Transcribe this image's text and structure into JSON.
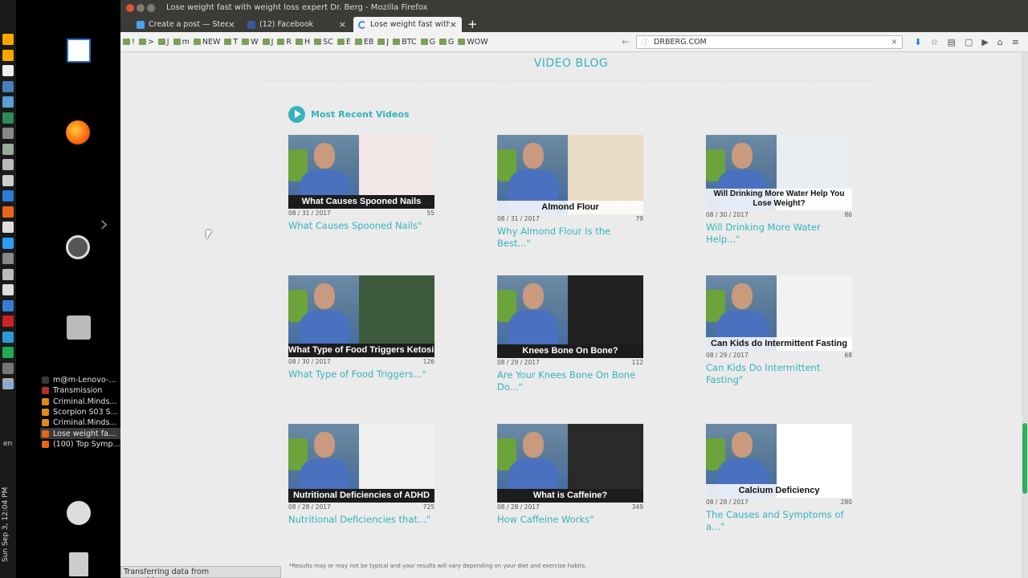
{
  "window": {
    "title": "Lose weight fast with weight loss expert Dr. Berg - Mozilla Firefox"
  },
  "tabs": [
    {
      "label": "Create a post — Steem",
      "favicon_color": "#4ba2f2"
    },
    {
      "label": "(12) Facebook",
      "favicon_color": "#3b5998"
    },
    {
      "label": "Lose weight fast with",
      "favicon_color": "#4a90d9"
    }
  ],
  "bookmarks": [
    "!",
    ">",
    "J",
    "m",
    "NEW",
    "T",
    "W",
    "J",
    "R",
    "H",
    "SC",
    "E",
    "EB",
    "J",
    "BTC",
    "G",
    "G",
    "WOW"
  ],
  "url": {
    "value": "DRBERG.COM",
    "info_icon": "info-icon"
  },
  "taskbar": {
    "items": [
      {
        "label": "m@m-Lenovo-...",
        "icon_color": "#3a3a3a",
        "active": false
      },
      {
        "label": "Transmission",
        "icon_color": "#b03030",
        "active": false
      },
      {
        "label": "Criminal.Minds...",
        "icon_color": "#e08a1e",
        "active": false
      },
      {
        "label": "Scorpion S03 S...",
        "icon_color": "#e08a1e",
        "active": false
      },
      {
        "label": "Criminal.Minds...",
        "icon_color": "#e08a1e",
        "active": false
      },
      {
        "label": "Lose weight fa...",
        "icon_color": "#e8661a",
        "active": true
      },
      {
        "label": "(100) Top Symp...",
        "icon_color": "#e8661a",
        "active": false
      }
    ],
    "lang": "EN",
    "lang_small": "en",
    "clock": "Sun Sep 3, 12:04 PM"
  },
  "page": {
    "section_title": "VIDEO BLOG",
    "recent_label": "Most Recent Videos",
    "disclaimer": "*Results may or may not be typical and your results will vary depending on your diet and exercise habits.",
    "videos": [
      {
        "caption": "What Causes Spooned Nails",
        "date": "08 / 31 / 2017",
        "views": "55",
        "title": "What Causes Spooned Nails\"",
        "caption_style": "dark",
        "accent": "#f3e6e6"
      },
      {
        "caption": "Almond Flour",
        "date": "08 / 31 / 2017",
        "views": "79",
        "title": "Why Almond Flour Is the Best...\"",
        "caption_style": "light",
        "accent": "#e9dcc4"
      },
      {
        "caption": "Will Drinking More Water Help You Lose Weight?",
        "date": "08 / 30 / 2017",
        "views": "86",
        "title": "Will Drinking More Water Help...\"",
        "caption_style": "two",
        "accent": "#e8eef2"
      },
      {
        "caption": "What Type of Food Triggers Ketosis",
        "date": "08 / 30 / 2017",
        "views": "126",
        "title": "What Type of Food Triggers...\"",
        "caption_style": "dark",
        "accent": "#3d5a3c"
      },
      {
        "caption": "Knees Bone On Bone?",
        "date": "08 / 29 / 2017",
        "views": "112",
        "title": "Are Your Knees Bone On Bone Do...\"",
        "caption_style": "dark",
        "accent": "#222222"
      },
      {
        "caption": "Can Kids do Intermittent Fasting",
        "date": "08 / 29 / 2017",
        "views": "68",
        "title": "Can Kids Do Intermittent Fasting\"",
        "caption_style": "light",
        "accent": "#f2f2f2"
      },
      {
        "caption": "Nutritional Deficiencies of ADHD",
        "date": "08 / 28 / 2017",
        "views": "725",
        "title": "Nutritional Deficiencies that...\"",
        "caption_style": "dark",
        "accent": "#f0f0f0"
      },
      {
        "caption": "What is Caffeine?",
        "date": "08 / 28 / 2017",
        "views": "349",
        "title": "How Caffeine Works\"",
        "caption_style": "dark",
        "accent": "#2a2a2a"
      },
      {
        "caption": "Calcium Deficiency",
        "date": "08 / 28 / 2017",
        "views": "280",
        "title": "The Causes and Symptoms of a...\"",
        "caption_style": "light",
        "accent": "#ffffff"
      }
    ]
  },
  "status": {
    "text": "Transferring data from www.drberg.com..."
  },
  "colors": {
    "accent": "#35b2bd",
    "scroll_thumb": "#2fb05b"
  }
}
